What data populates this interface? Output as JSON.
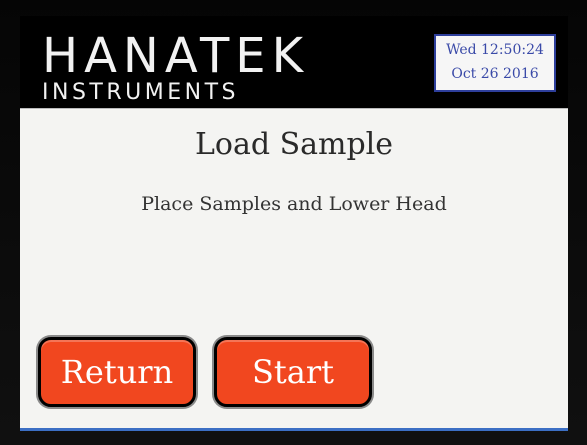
{
  "header": {
    "brand_name": "HANATEK",
    "brand_subtitle": "INSTRUMENTS",
    "clock_line1": "Wed 12:50:24",
    "clock_line2": "Oct 26  2016"
  },
  "main": {
    "title": "Load Sample",
    "message": "Place Samples and Lower Head"
  },
  "buttons": {
    "return_label": "Return",
    "start_label": "Start"
  },
  "colors": {
    "button": "#f1471f",
    "clock_text": "#3a4aa8",
    "panel": "#f4f4f2"
  }
}
